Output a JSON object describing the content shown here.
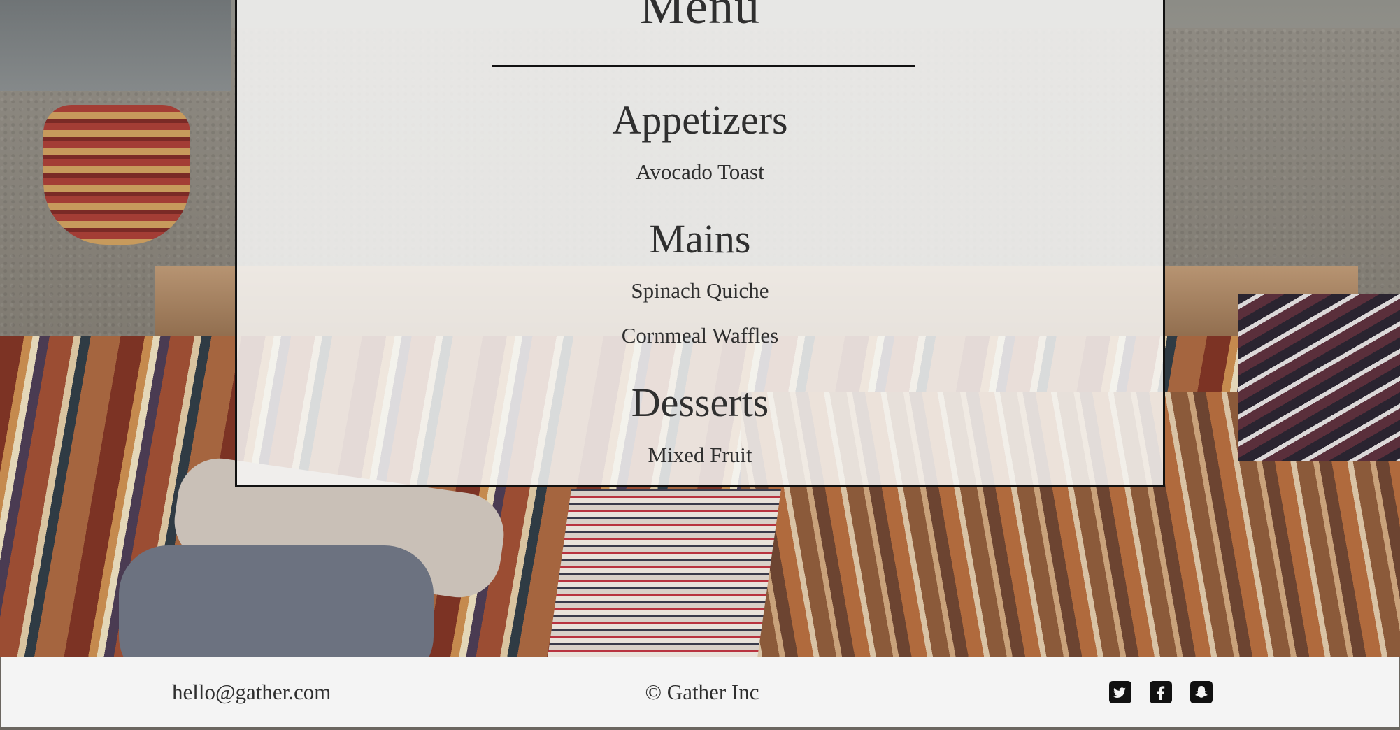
{
  "menu": {
    "title": "Menu",
    "sections": [
      {
        "heading": "Appetizers",
        "items": [
          "Avocado Toast"
        ]
      },
      {
        "heading": "Mains",
        "items": [
          "Spinach Quiche",
          "Cornmeal Waffles"
        ]
      },
      {
        "heading": "Desserts",
        "items": [
          "Mixed Fruit"
        ]
      }
    ]
  },
  "footer": {
    "email": "hello@gather.com",
    "copyright": "© Gather Inc",
    "social": [
      {
        "icon": "twitter-icon"
      },
      {
        "icon": "facebook-icon"
      },
      {
        "icon": "snapchat-icon"
      }
    ]
  },
  "colors": {
    "text": "#2f2f2f",
    "border": "#111111",
    "footer_bg": "#f4f4f4"
  }
}
